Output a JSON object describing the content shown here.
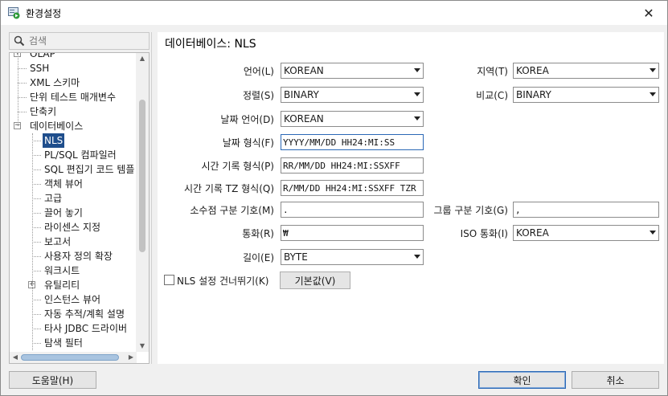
{
  "window": {
    "title": "환경설정",
    "close_glyph": "✕"
  },
  "search": {
    "placeholder": "검색"
  },
  "tree": {
    "items": [
      {
        "label": "OLAP",
        "expander": "+"
      },
      {
        "label": "SSH"
      },
      {
        "label": "XML 스키마"
      },
      {
        "label": "단위 테스트 매개변수"
      },
      {
        "label": "단축키"
      },
      {
        "label": "데이터베이스",
        "expander": "−"
      },
      {
        "label": "NLS",
        "selected": true
      },
      {
        "label": "PL/SQL 컴파일러"
      },
      {
        "label": "SQL 편집기 코드 템플"
      },
      {
        "label": "객체 뷰어"
      },
      {
        "label": "고급"
      },
      {
        "label": "끌어 놓기"
      },
      {
        "label": "라이센스 지정"
      },
      {
        "label": "보고서"
      },
      {
        "label": "사용자 정의 확장"
      },
      {
        "label": "워크시트"
      },
      {
        "label": "유틸리티",
        "expander": "+"
      },
      {
        "label": "인스턴스 뷰어"
      },
      {
        "label": "자동 추적/계획 설명"
      },
      {
        "label": "타사 JDBC 드라이버"
      },
      {
        "label": "탐색 필터"
      }
    ]
  },
  "panel": {
    "title": "데이터베이스: NLS",
    "language": {
      "label": "언어(L)",
      "value": "KOREAN"
    },
    "territory": {
      "label": "지역(T)",
      "value": "KOREA"
    },
    "sort": {
      "label": "정렬(S)",
      "value": "BINARY"
    },
    "comp": {
      "label": "비교(C)",
      "value": "BINARY"
    },
    "date_language": {
      "label": "날짜 언어(D)",
      "value": "KOREAN"
    },
    "date_format": {
      "label": "날짜 형식(F)",
      "value": "YYYY/MM/DD HH24:MI:SS"
    },
    "timestamp_format": {
      "label": "시간 기록 형식(P)",
      "value": "RR/MM/DD HH24:MI:SSXFF"
    },
    "timestamp_tz_format": {
      "label": "시간 기록 TZ 형식(Q)",
      "value": "R/MM/DD HH24:MI:SSXFF TZR"
    },
    "decimal_sep": {
      "label": "소수점 구분 기호(M)",
      "value": "."
    },
    "group_sep": {
      "label": "그룹 구분 기호(G)",
      "value": ","
    },
    "currency": {
      "label": "통화(R)",
      "value": "₩"
    },
    "iso_currency": {
      "label": "ISO 통화(I)",
      "value": "KOREA"
    },
    "length": {
      "label": "길이(E)",
      "value": "BYTE"
    },
    "skip_nls": {
      "label": "NLS 설정 건너뛰기(K)",
      "checked": false
    },
    "default_button": "기본값(V)"
  },
  "footer": {
    "help": "도움말(H)",
    "ok": "확인",
    "cancel": "취소"
  },
  "colors": {
    "selection": "#1f4e8c",
    "accent": "#2b68b6"
  }
}
